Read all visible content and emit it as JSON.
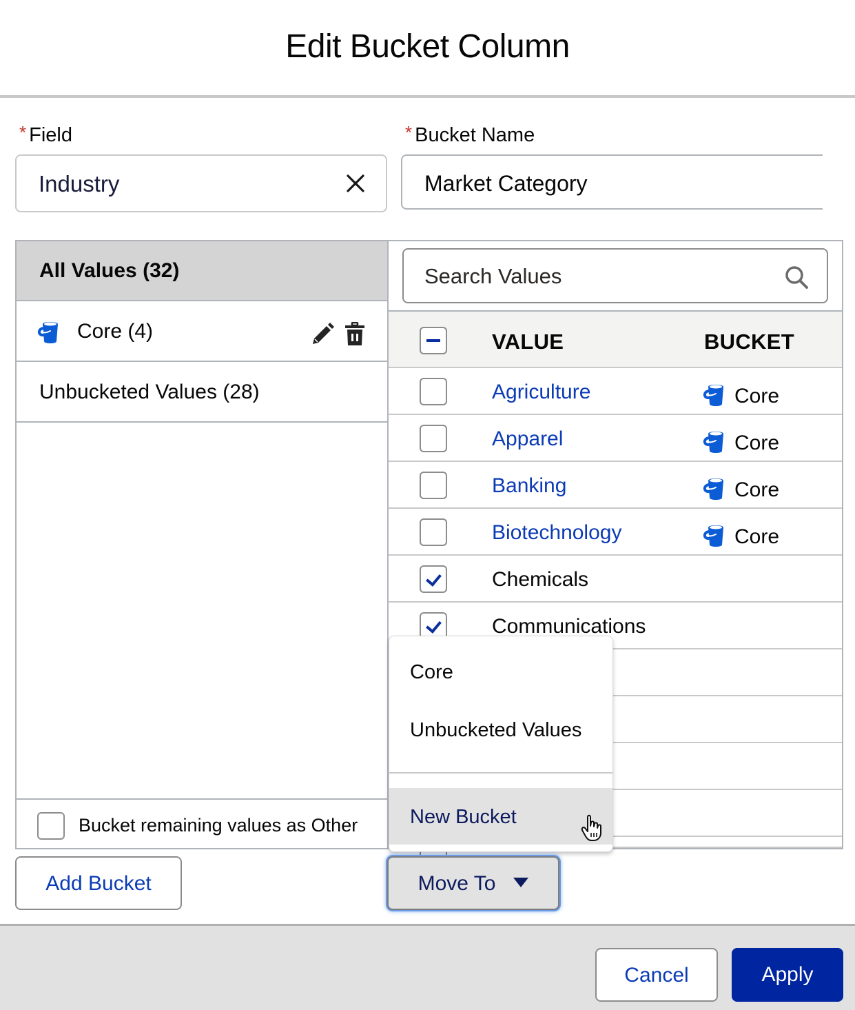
{
  "dialog": {
    "title": "Edit Bucket Column"
  },
  "form": {
    "required_marker": "*",
    "field_label": "Field",
    "field_value": "Industry",
    "bucket_name_label": "Bucket Name",
    "bucket_name_value": "Market Category"
  },
  "left_panel": {
    "all_values": "All Values (32)",
    "buckets": [
      {
        "label": "Core (4)",
        "icon": "bucket-icon"
      },
      {
        "label": "Unbucketed Values (28)"
      }
    ],
    "other_option": {
      "label": "Bucket remaining values as Other",
      "checked": false
    }
  },
  "right_panel": {
    "search_placeholder": "Search Values",
    "columns": {
      "value": "VALUE",
      "bucket": "BUCKET"
    },
    "select_all_state": "indeterminate",
    "rows": [
      {
        "value": "Agriculture",
        "bucket": "Core",
        "checked": false
      },
      {
        "value": "Apparel",
        "bucket": "Core",
        "checked": false
      },
      {
        "value": "Banking",
        "bucket": "Core",
        "checked": false
      },
      {
        "value": "Biotechnology",
        "bucket": "Core",
        "checked": false
      },
      {
        "value": "Chemicals",
        "bucket": "",
        "checked": true
      },
      {
        "value": "Communications",
        "bucket": "",
        "checked": true
      },
      {
        "value": "",
        "bucket": "",
        "checked": false
      },
      {
        "value": "",
        "bucket": "",
        "checked": false
      },
      {
        "value": "",
        "bucket": "",
        "checked": false
      },
      {
        "value": "",
        "bucket": "",
        "checked": false
      },
      {
        "value": "",
        "bucket": "",
        "checked": false
      }
    ]
  },
  "move_to_menu": {
    "items": [
      "Core",
      "Unbucketed Values"
    ],
    "new_bucket": "New Bucket"
  },
  "actions": {
    "add_bucket": "Add Bucket",
    "move_to": "Move To",
    "cancel": "Cancel",
    "apply": "Apply"
  },
  "colors": {
    "accent": "#0025a0",
    "link": "#0b3bb5",
    "bucket_icon": "#0b5cd5",
    "required": "#c23934"
  }
}
